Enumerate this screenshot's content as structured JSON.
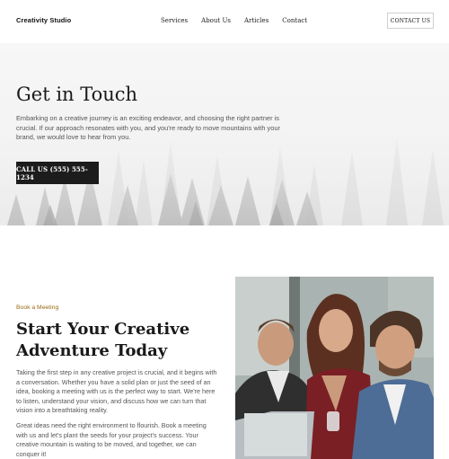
{
  "header": {
    "brand": "Creativity Studio",
    "nav": [
      "Services",
      "About Us",
      "Articles",
      "Contact"
    ],
    "cta": "CONTACT US"
  },
  "hero": {
    "title": "Get in Touch",
    "text": "Embarking on a creative journey is an exciting endeavor, and choosing the right partner is crucial. If our approach resonates with you, and you're ready to move mountains with your brand, we would love to hear from you.",
    "button": "CALL US (555) 555-1234"
  },
  "meeting": {
    "eyebrow": "Book a Meeting",
    "title": "Start Your Creative Adventure Today",
    "para1": "Taking the first step in any creative project is crucial, and it begins with a conversation. Whether you have a solid plan or just the seed of an idea, booking a meeting with us is the perfect way to start. We're here to listen, understand your vision, and discuss how we can turn that vision into a breathtaking reality.",
    "para2": "Great ideas need the right environment to flourish. Book a meeting with us and let's plant the seeds for your project's success. Your creative mountain is waiting to be moved, and together, we can conquer it!"
  },
  "colors": {
    "accent": "#9a6a14",
    "button_dark": "#1c1c1c"
  },
  "icons": {
    "hero_background": "misty-forest-image",
    "meeting_photo": "team-meeting-photo"
  }
}
